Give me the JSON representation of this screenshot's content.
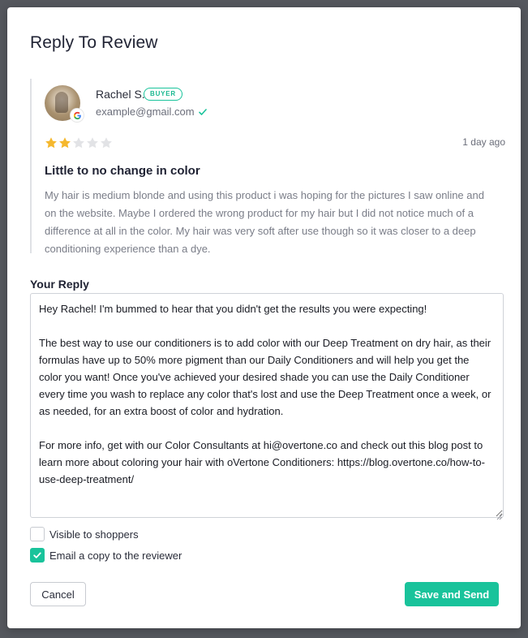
{
  "modal": {
    "title": "Reply To Review"
  },
  "review": {
    "reviewer_name": "Rachel S.",
    "badge": "BUYER",
    "email": "example@gmail.com",
    "rating": 2,
    "max_rating": 5,
    "date": "1 day ago",
    "title": "Little to no change in color",
    "body": "My hair is medium blonde and using this product i was hoping for the pictures I saw online and on the website. Maybe I ordered the wrong product for my hair but I did not notice much of a difference at all in the color. My hair was very soft after use though so it was closer to a deep conditioning experience than a dye."
  },
  "reply": {
    "label": "Your Reply",
    "value": "Hey Rachel! I'm bummed to hear that you didn't get the results you were expecting!\n\nThe best way to use our conditioners is to add color with our Deep Treatment on dry hair, as their formulas have up to 50% more pigment than our Daily Conditioners and will help you get the color you want! Once you've achieved your desired shade you can use the Daily Conditioner every time you wash to replace any color that's lost and use the Deep Treatment once a week, or as needed, for an extra boost of color and hydration.\n\nFor more info, get with our Color Consultants at hi@overtone.co and check out this blog post to learn more about coloring your hair with oVertone Conditioners: https://blog.overtone.co/how-to-use-deep-treatment/"
  },
  "options": {
    "visible_label": "Visible to shoppers",
    "visible_checked": false,
    "email_label": "Email a copy to the reviewer",
    "email_checked": true
  },
  "buttons": {
    "cancel": "Cancel",
    "save": "Save and Send"
  },
  "colors": {
    "accent": "#19c39b",
    "star_filled": "#f5b82e",
    "star_empty": "#e2e3e6"
  },
  "icons": {
    "badge": "google-icon",
    "verified": "check-icon",
    "star": "star-icon",
    "checkbox_check": "check-icon"
  }
}
